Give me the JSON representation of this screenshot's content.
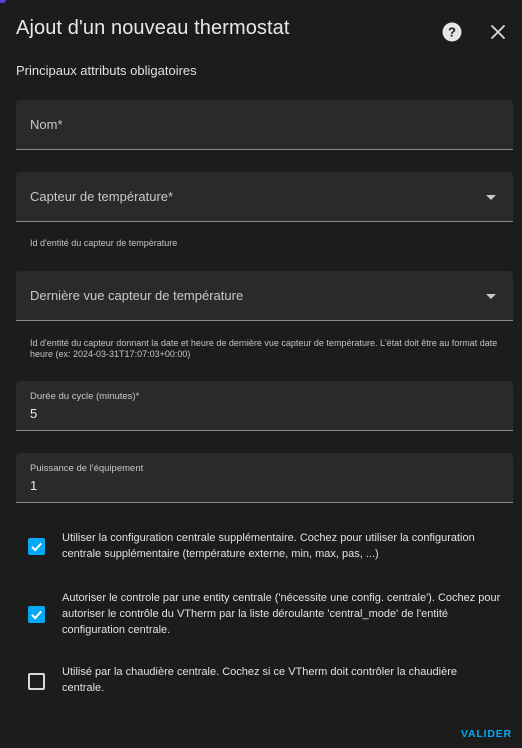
{
  "dialog": {
    "title": "Ajout d'un nouveau thermostat",
    "subtitle": "Principaux attributs obligatoires"
  },
  "fields": {
    "name": {
      "placeholder": "Nom*"
    },
    "temp_sensor": {
      "placeholder": "Capteur de température*",
      "helper": "Id d'entité du capteur de température"
    },
    "last_seen_sensor": {
      "placeholder": "Dernière vue capteur de température",
      "helper": "Id d'entité du capteur donnant la date et heure de dernière vue capteur de température. L'état doit être au format date heure (ex: 2024-03-31T17:07:03+00:00)"
    },
    "cycle_duration": {
      "label": "Durée du cycle (minutes)*",
      "value": "5"
    },
    "power": {
      "label": "Puissance de l'équipement",
      "value": "1"
    }
  },
  "checkboxes": [
    {
      "checked": true,
      "label": "Utiliser la configuration centrale supplémentaire. Cochez pour utiliser la configuration centrale supplémentaire (température externe, min, max, pas, ...)"
    },
    {
      "checked": true,
      "label": "Autoriser le controle par une entity centrale ('nécessite une config. centrale'). Cochez pour autoriser le contrôle du VTherm par la liste déroulante 'central_mode' de l'entité configuration centrale."
    },
    {
      "checked": false,
      "label": "Utilisé par la chaudière centrale. Cochez si ce VTherm doit contrôler la chaudière centrale."
    }
  ],
  "actions": {
    "submit_label": "VALIDER"
  },
  "colors": {
    "accent": "#03a9f4",
    "background": "#1c1c1c",
    "field": "#2a2a2a"
  },
  "icons": {
    "help": "help-circle-icon",
    "close": "close-icon"
  }
}
